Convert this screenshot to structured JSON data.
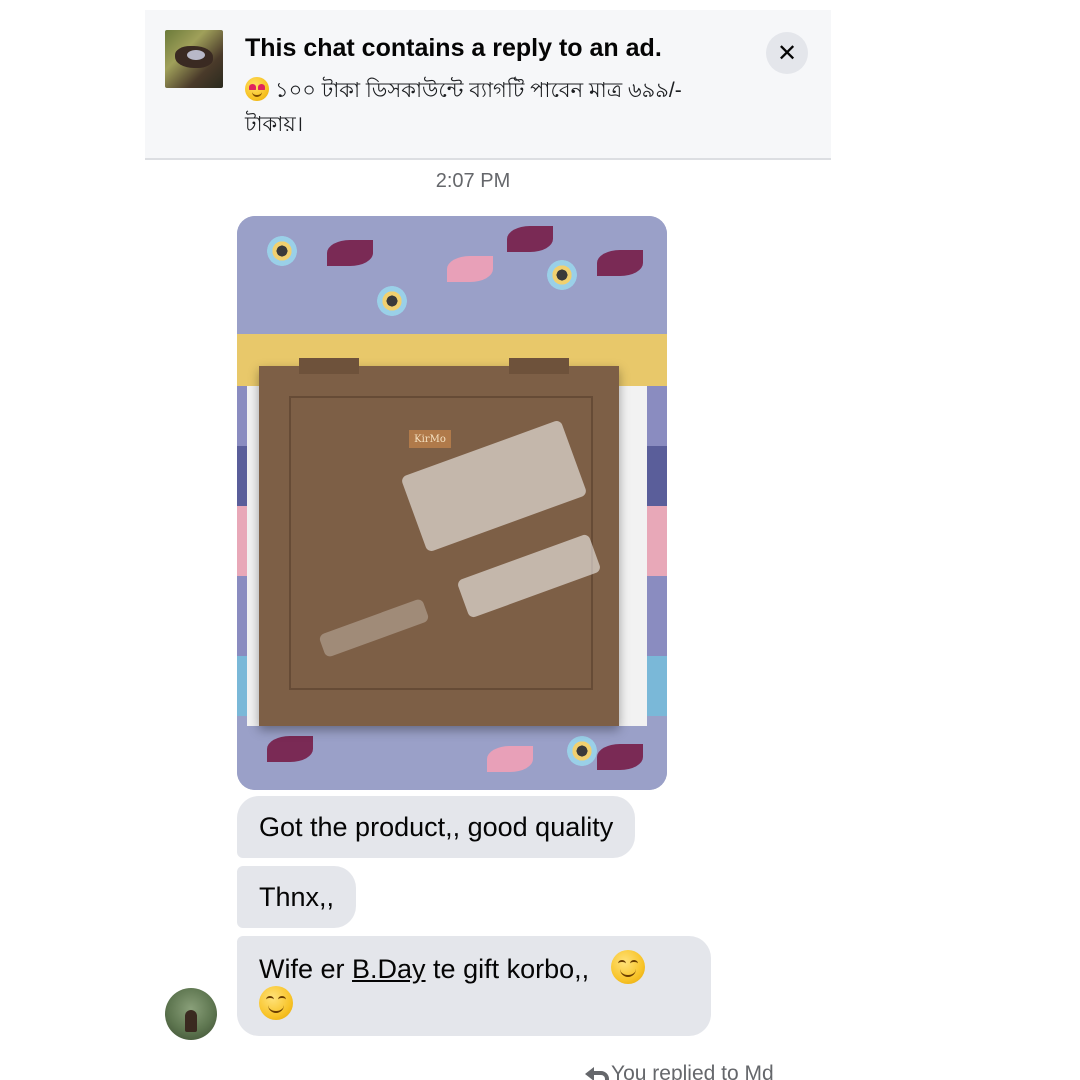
{
  "ad_banner": {
    "title": "This chat contains a reply to an ad.",
    "snippet": "১০০ টাকা ডিসকাউন্টে ব্যাগটি পাবেন মাত্র ৬৯৯/- টাকায়।",
    "snippet_emoji": "smiling-face-with-heart-eyes",
    "close_label": "✕"
  },
  "conversation": {
    "timestamp": "2:07 PM",
    "photo": {
      "bag_color": "#7d5f46",
      "label_text": "KirMo"
    },
    "messages": [
      {
        "text": "Got the product,, good quality"
      },
      {
        "text": "Thnx,,"
      },
      {
        "text_before": "Wife er ",
        "link_text": "B.Day",
        "text_after": " te gift korbo,,",
        "emoji": "smiling-face"
      }
    ],
    "footer_note": "You replied to Md"
  },
  "colors": {
    "bubble_bg": "#e4e6eb",
    "banner_bg": "#f6f7f9",
    "secondary_text": "#65676b"
  }
}
